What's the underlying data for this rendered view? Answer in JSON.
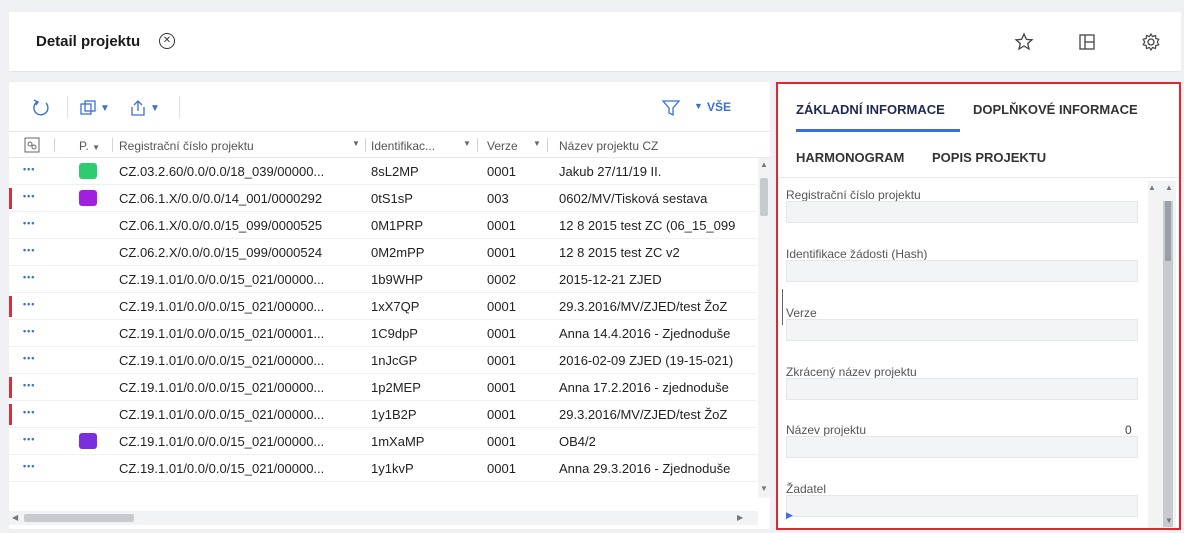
{
  "header": {
    "title": "Detail projektu",
    "icons": [
      "close-circle-icon",
      "star-icon",
      "layout-icon",
      "gear-icon"
    ]
  },
  "toolbar": {
    "icons": [
      "refresh-icon",
      "copy-dropdown-icon",
      "export-dropdown-icon",
      "filter-icon"
    ],
    "vse_label": "VŠE"
  },
  "grid": {
    "columns": {
      "p": "P.",
      "reg": "Registrační číslo projektu",
      "ident": "Identifikac...",
      "verze": "Verze",
      "nazev": "Název projektu CZ"
    },
    "rows": [
      {
        "flag": false,
        "chip": "#2ecc71",
        "reg": "CZ.03.2.60/0.0/0.0/18_039/00000...",
        "ident": "8sL2MP",
        "ver": "0001",
        "name": "Jakub 27/11/19 II."
      },
      {
        "flag": true,
        "chip": "#a020e0",
        "reg": "CZ.06.1.X/0.0/0.0/14_001/0000292",
        "ident": "0tS1sP",
        "ver": "003",
        "name": "0602/MV/Tisková sestava"
      },
      {
        "flag": false,
        "chip": "",
        "reg": "CZ.06.1.X/0.0/0.0/15_099/0000525",
        "ident": "0M1PRP",
        "ver": "0001",
        "name": "12 8 2015 test ZC (06_15_099"
      },
      {
        "flag": false,
        "chip": "",
        "reg": "CZ.06.2.X/0.0/0.0/15_099/0000524",
        "ident": "0M2mPP",
        "ver": "0001",
        "name": "12 8 2015 test ZC v2"
      },
      {
        "flag": false,
        "chip": "",
        "reg": "CZ.19.1.01/0.0/0.0/15_021/00000...",
        "ident": "1b9WHP",
        "ver": "0002",
        "name": "2015-12-21 ZJED"
      },
      {
        "flag": true,
        "chip": "",
        "reg": "CZ.19.1.01/0.0/0.0/15_021/00000...",
        "ident": "1xX7QP",
        "ver": "0001",
        "name": "29.3.2016/MV/ZJED/test ŽoZ"
      },
      {
        "flag": false,
        "chip": "",
        "reg": "CZ.19.1.01/0.0/0.0/15_021/00001...",
        "ident": "1C9dpP",
        "ver": "0001",
        "name": "Anna 14.4.2016 - Zjednoduše"
      },
      {
        "flag": false,
        "chip": "",
        "reg": "CZ.19.1.01/0.0/0.0/15_021/00000...",
        "ident": "1nJcGP",
        "ver": "0001",
        "name": "2016-02-09 ZJED (19-15-021)"
      },
      {
        "flag": true,
        "chip": "",
        "reg": "CZ.19.1.01/0.0/0.0/15_021/00000...",
        "ident": "1p2MEP",
        "ver": "0001",
        "name": "Anna 17.2.2016 - zjednoduše"
      },
      {
        "flag": true,
        "chip": "",
        "reg": "CZ.19.1.01/0.0/0.0/15_021/00000...",
        "ident": "1y1B2P",
        "ver": "0001",
        "name": "29.3.2016/MV/ZJED/test ŽoZ"
      },
      {
        "flag": false,
        "chip": "#7b2ee0",
        "reg": "CZ.19.1.01/0.0/0.0/15_021/00000...",
        "ident": "1mXaMP",
        "ver": "0001",
        "name": "OB4/2"
      },
      {
        "flag": false,
        "chip": "",
        "reg": "CZ.19.1.01/0.0/0.0/15_021/00000...",
        "ident": "1y1kvP",
        "ver": "0001",
        "name": "Anna 29.3.2016 - Zjednoduše"
      }
    ]
  },
  "detail": {
    "tabs": {
      "zakladni": "ZÁKLADNÍ INFORMACE",
      "doplnkove": "DOPLŇKOVÉ INFORMACE",
      "harmonogram": "HARMONOGRAM",
      "popis": "POPIS PROJEKTU"
    },
    "fields": {
      "reg": "Registrační číslo projektu",
      "ident": "Identifikace žádosti (Hash)",
      "verze": "Verze",
      "zkraceny": "Zkrácený název projektu",
      "nazev": "Název projektu",
      "nazev_count": "0",
      "zadatel": "Žadatel"
    }
  },
  "colors": {
    "accent": "#3a6fd6",
    "highlight_border": "#e0262e",
    "flag": "#d8303a"
  }
}
